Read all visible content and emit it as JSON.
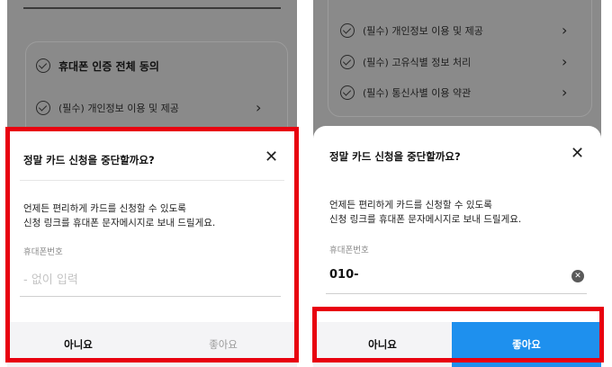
{
  "colors": {
    "highlight": "#e8000f",
    "confirm_active": "#1e90ee",
    "dim_overlay": "#8a8a8a"
  },
  "left_screen": {
    "background": {
      "consent_all": "휴대폰 인증 전체 동의",
      "items": [
        {
          "label": "(필수) 개인정보 이용 및 제공"
        }
      ]
    },
    "sheet": {
      "title": "정말 카드 신청을 중단할까요?",
      "description_line1": "언제든 편리하게 카드를 신청할 수 있도록",
      "description_line2": "신청 링크를 휴대폰 문자메시지로 보내 드릴게요.",
      "phone_label": "휴대폰번호",
      "phone_placeholder": "- 없이 입력",
      "no_label": "아니요",
      "yes_label": "좋아요"
    }
  },
  "right_screen": {
    "background": {
      "items": [
        {
          "label": "(필수) 개인정보 이용 및 제공"
        },
        {
          "label": "(필수) 고유식별 정보 처리"
        },
        {
          "label": "(필수) 통신사별 이용 약관"
        }
      ]
    },
    "sheet": {
      "title": "정말 카드 신청을 중단할까요?",
      "description_line1": "언제든 편리하게 카드를 신청할 수 있도록",
      "description_line2": "신청 링크를 휴대폰 문자메시지로 보내 드릴게요.",
      "phone_label": "휴대폰번호",
      "phone_value": "010-",
      "no_label": "아니요",
      "yes_label": "좋아요"
    }
  }
}
